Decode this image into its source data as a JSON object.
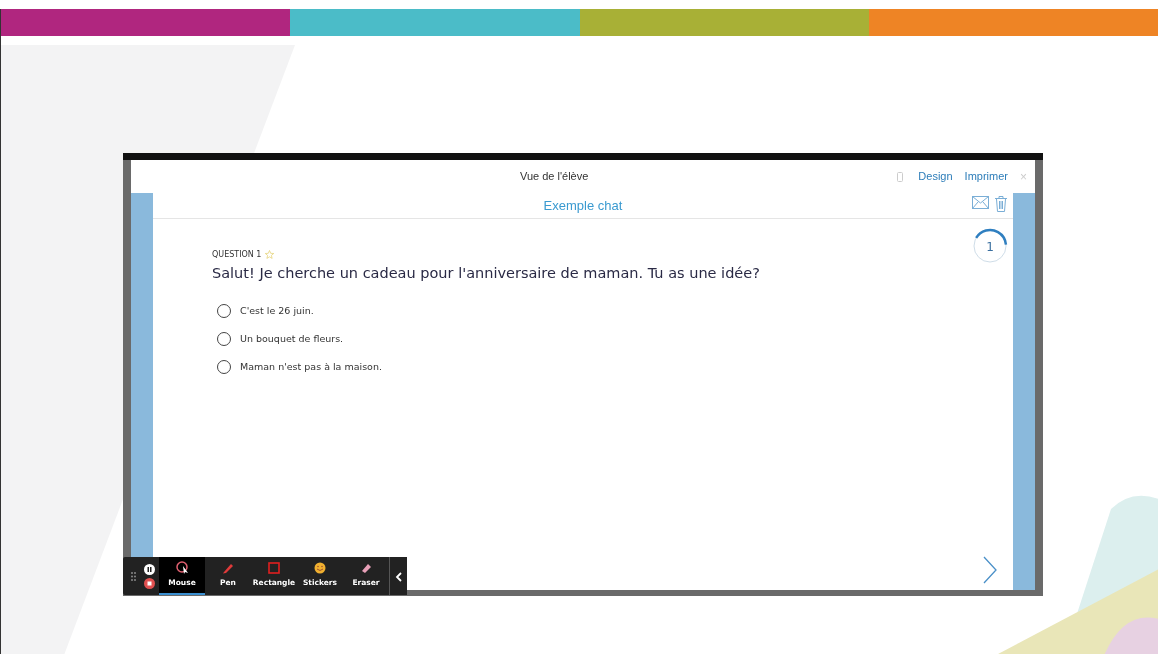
{
  "slide_bars": [
    {
      "color": "#b0267f"
    },
    {
      "color": "#4bbcc8"
    },
    {
      "color": "#a8b036"
    },
    {
      "color": "#ee8425"
    }
  ],
  "window": {
    "title": "Vue de l'élève",
    "links": [
      "Design",
      "Imprimer"
    ],
    "close": "×"
  },
  "quiz": {
    "title": "Exemple chat",
    "timer": {
      "label": "1"
    },
    "question": {
      "number": "QUESTION 1",
      "starred": false,
      "text": "Salut! Je cherche un cadeau pour l'anniversaire de maman. Tu as une idée?"
    },
    "options": [
      {
        "label": "C'est le 26 juin.",
        "checked": false
      },
      {
        "label": "Un bouquet de fleurs.",
        "checked": false
      },
      {
        "label": "Maman n'est pas à la maison.",
        "checked": false
      }
    ]
  },
  "toolbar": {
    "tools": [
      {
        "kind": "mouse",
        "label": "Mouse",
        "selected": true
      },
      {
        "kind": "pen",
        "label": "Pen",
        "selected": false
      },
      {
        "kind": "rectangle",
        "label": "Rectangle",
        "selected": false
      },
      {
        "kind": "stickers",
        "label": "Stickers",
        "selected": false
      },
      {
        "kind": "eraser",
        "label": "Eraser",
        "selected": false
      }
    ]
  }
}
